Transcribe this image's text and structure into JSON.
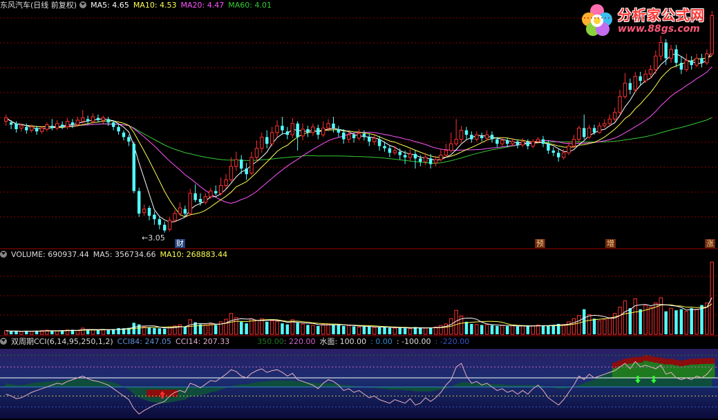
{
  "stock": {
    "title": "东风汽车(日线 前复权)",
    "ma5_label": "MA5: 4.65",
    "ma10_label": "MA10: 4.53",
    "ma20_label": "MA20: 4.47",
    "ma60_label": "MA60: 4.01"
  },
  "volume": {
    "label": "VOLUME: 690937.44",
    "ma5_label": "MA5: 356734.66",
    "ma10_label": "MA10: 268883.44"
  },
  "indicator": {
    "name": "双周期CCI(6,14,95,250,1,2)",
    "cci84_label": "CCI84: 247.05",
    "cci14_label": "CCI14: 207.33",
    "l350": "350.00",
    "l220": ": 220.00",
    "water": "水面: 100.00",
    "l0": ": 0.00",
    "lm100": ": -100.00",
    "lm220": ": -220.00"
  },
  "markers": {
    "cai": "财",
    "yu": "预",
    "zeng": "增",
    "zhang": "涨",
    "low": "←3.05"
  },
  "logo": {
    "main": "分析家公式网",
    "sub": "www.88gs.com"
  },
  "colors": {
    "up": "#ff3232",
    "down": "#54ffff",
    "ma5": "#ffffff",
    "ma10": "#ffff55",
    "ma20": "#ff55ff",
    "ma60": "#33cc33",
    "grid": "#8b0000"
  },
  "chart_data": [
    {
      "type": "candlestick",
      "name": "price",
      "ylim": [
        2.9,
        5.0
      ],
      "candles": [
        [
          4.02,
          4.05,
          4.08,
          3.98
        ],
        [
          4.01,
          3.99,
          4.03,
          3.95
        ],
        [
          4.0,
          3.95,
          4.02,
          3.92
        ],
        [
          3.96,
          3.98,
          4.0,
          3.93
        ],
        [
          3.97,
          3.94,
          4.0,
          3.91
        ],
        [
          3.94,
          3.97,
          3.99,
          3.92
        ],
        [
          3.96,
          3.93,
          3.98,
          3.9
        ],
        [
          3.93,
          3.96,
          3.98,
          3.91
        ],
        [
          3.95,
          3.99,
          4.01,
          3.93
        ],
        [
          3.98,
          3.96,
          4.04,
          3.94
        ],
        [
          3.96,
          4.0,
          4.03,
          3.94
        ],
        [
          3.99,
          3.97,
          4.02,
          3.95
        ],
        [
          3.97,
          4.02,
          4.05,
          3.95
        ],
        [
          4.01,
          3.99,
          4.04,
          3.96
        ],
        [
          3.99,
          4.03,
          4.06,
          3.97
        ],
        [
          4.02,
          4.05,
          4.12,
          4.0
        ],
        [
          4.04,
          4.02,
          4.07,
          3.99
        ],
        [
          4.02,
          4.06,
          4.09,
          4.0
        ],
        [
          4.05,
          4.03,
          4.08,
          4.01
        ],
        [
          4.03,
          4.05,
          4.07,
          4.0
        ],
        [
          4.04,
          4.01,
          4.06,
          3.98
        ],
        [
          4.01,
          3.97,
          4.03,
          3.94
        ],
        [
          3.97,
          3.93,
          3.99,
          3.9
        ],
        [
          3.92,
          3.88,
          3.94,
          3.85
        ],
        [
          3.88,
          3.84,
          3.9,
          3.8
        ],
        [
          3.82,
          3.4,
          3.84,
          3.38
        ],
        [
          3.4,
          3.2,
          3.43,
          3.17
        ],
        [
          3.21,
          3.24,
          3.28,
          3.18
        ],
        [
          3.25,
          3.18,
          3.27,
          3.14
        ],
        [
          3.19,
          3.15,
          3.22,
          3.1
        ],
        [
          3.15,
          3.1,
          3.18,
          3.06
        ],
        [
          3.1,
          3.05,
          3.13,
          3.03
        ],
        [
          3.06,
          3.14,
          3.17,
          3.04
        ],
        [
          3.14,
          3.2,
          3.23,
          3.12
        ],
        [
          3.2,
          3.25,
          3.3,
          3.18
        ],
        [
          3.24,
          3.2,
          3.27,
          3.17
        ],
        [
          3.2,
          3.38,
          3.42,
          3.18
        ],
        [
          3.38,
          3.32,
          3.46,
          3.3
        ],
        [
          3.33,
          3.3,
          3.38,
          3.27
        ],
        [
          3.3,
          3.35,
          3.38,
          3.28
        ],
        [
          3.35,
          3.4,
          3.43,
          3.33
        ],
        [
          3.4,
          3.38,
          3.45,
          3.36
        ],
        [
          3.38,
          3.45,
          3.52,
          3.36
        ],
        [
          3.45,
          3.5,
          3.55,
          3.42
        ],
        [
          3.5,
          3.62,
          3.7,
          3.48
        ],
        [
          3.62,
          3.68,
          3.75,
          3.58
        ],
        [
          3.68,
          3.6,
          3.72,
          3.55
        ],
        [
          3.6,
          3.55,
          3.65,
          3.5
        ],
        [
          3.56,
          3.7,
          3.75,
          3.54
        ],
        [
          3.7,
          3.78,
          3.85,
          3.66
        ],
        [
          3.78,
          3.88,
          3.92,
          3.74
        ],
        [
          3.88,
          3.82,
          3.94,
          3.78
        ],
        [
          3.82,
          3.92,
          3.97,
          3.8
        ],
        [
          3.92,
          3.98,
          4.03,
          3.88
        ],
        [
          3.98,
          3.94,
          4.06,
          3.9
        ],
        [
          3.93,
          3.9,
          3.97,
          3.86
        ],
        [
          3.9,
          4.0,
          4.05,
          3.87
        ],
        [
          4.0,
          3.88,
          4.02,
          3.76
        ],
        [
          3.89,
          3.95,
          4.0,
          3.85
        ],
        [
          3.95,
          3.92,
          3.98,
          3.88
        ],
        [
          3.92,
          3.97,
          4.0,
          3.89
        ],
        [
          3.96,
          3.9,
          3.99,
          3.86
        ],
        [
          3.9,
          3.96,
          4.02,
          3.88
        ],
        [
          3.96,
          4.0,
          4.04,
          3.93
        ],
        [
          4.0,
          3.96,
          4.06,
          3.92
        ],
        [
          3.95,
          3.92,
          3.98,
          3.88
        ],
        [
          3.92,
          3.86,
          3.95,
          3.82
        ],
        [
          3.86,
          3.9,
          3.93,
          3.83
        ],
        [
          3.9,
          3.87,
          3.92,
          3.83
        ],
        [
          3.87,
          3.91,
          3.95,
          3.85
        ],
        [
          3.91,
          3.88,
          3.94,
          3.85
        ],
        [
          3.88,
          3.84,
          3.91,
          3.8
        ],
        [
          3.84,
          3.87,
          3.9,
          3.81
        ],
        [
          3.86,
          3.8,
          3.89,
          3.76
        ],
        [
          3.8,
          3.78,
          3.84,
          3.75
        ],
        [
          3.78,
          3.74,
          3.81,
          3.7
        ],
        [
          3.74,
          3.76,
          3.8,
          3.72
        ],
        [
          3.75,
          3.72,
          3.78,
          3.68
        ],
        [
          3.72,
          3.7,
          3.76,
          3.64
        ],
        [
          3.7,
          3.73,
          3.77,
          3.67
        ],
        [
          3.73,
          3.69,
          3.76,
          3.6
        ],
        [
          3.69,
          3.66,
          3.72,
          3.62
        ],
        [
          3.66,
          3.7,
          3.74,
          3.63
        ],
        [
          3.69,
          3.64,
          3.73,
          3.6
        ],
        [
          3.65,
          3.68,
          3.71,
          3.62
        ],
        [
          3.68,
          3.72,
          3.77,
          3.66
        ],
        [
          3.72,
          3.76,
          3.82,
          3.7
        ],
        [
          3.76,
          3.82,
          3.92,
          3.74
        ],
        [
          3.82,
          3.86,
          4.04,
          3.8
        ],
        [
          3.86,
          3.94,
          3.98,
          3.83
        ],
        [
          3.94,
          3.9,
          3.97,
          3.86
        ],
        [
          3.9,
          3.86,
          3.93,
          3.83
        ],
        [
          3.86,
          3.9,
          3.93,
          3.84
        ],
        [
          3.89,
          3.87,
          3.92,
          3.84
        ],
        [
          3.87,
          3.9,
          3.94,
          3.85
        ],
        [
          3.9,
          3.86,
          3.93,
          3.83
        ],
        [
          3.86,
          3.82,
          3.88,
          3.79
        ],
        [
          3.82,
          3.85,
          3.88,
          3.8
        ],
        [
          3.85,
          3.82,
          3.87,
          3.79
        ],
        [
          3.82,
          3.84,
          3.87,
          3.8
        ],
        [
          3.84,
          3.81,
          3.86,
          3.78
        ],
        [
          3.81,
          3.84,
          3.87,
          3.79
        ],
        [
          3.84,
          3.8,
          3.86,
          3.77
        ],
        [
          3.8,
          3.84,
          3.86,
          3.78
        ],
        [
          3.84,
          3.86,
          3.88,
          3.82
        ],
        [
          3.86,
          3.82,
          3.89,
          3.79
        ],
        [
          3.82,
          3.76,
          3.85,
          3.73
        ],
        [
          3.76,
          3.74,
          3.79,
          3.71
        ],
        [
          3.74,
          3.7,
          3.77,
          3.66
        ],
        [
          3.7,
          3.74,
          3.77,
          3.68
        ],
        [
          3.74,
          3.8,
          3.84,
          3.72
        ],
        [
          3.8,
          3.86,
          3.9,
          3.78
        ],
        [
          3.86,
          3.96,
          3.98,
          3.84
        ],
        [
          3.96,
          3.88,
          4.08,
          3.86
        ],
        [
          3.88,
          3.96,
          3.99,
          3.86
        ],
        [
          3.96,
          3.92,
          3.99,
          3.9
        ],
        [
          3.92,
          3.98,
          4.01,
          3.91
        ],
        [
          3.98,
          4.0,
          4.04,
          3.96
        ],
        [
          4.0,
          4.04,
          4.08,
          3.98
        ],
        [
          4.04,
          4.1,
          4.14,
          4.02
        ],
        [
          4.1,
          4.24,
          4.3,
          4.08
        ],
        [
          4.24,
          4.36,
          4.45,
          4.22
        ],
        [
          4.36,
          4.3,
          4.4,
          4.26
        ],
        [
          4.3,
          4.42,
          4.46,
          4.28
        ],
        [
          4.42,
          4.38,
          4.46,
          4.34
        ],
        [
          4.38,
          4.44,
          4.48,
          4.36
        ],
        [
          4.44,
          4.48,
          4.52,
          4.4
        ],
        [
          4.48,
          4.6,
          4.65,
          4.44
        ],
        [
          4.6,
          4.72,
          4.78,
          4.56
        ],
        [
          4.72,
          4.58,
          4.75,
          4.52
        ],
        [
          4.58,
          4.66,
          4.7,
          4.54
        ],
        [
          4.66,
          4.54,
          4.7,
          4.5
        ],
        [
          4.54,
          4.48,
          4.6,
          4.44
        ],
        [
          4.48,
          4.56,
          4.62,
          4.46
        ],
        [
          4.56,
          4.52,
          4.6,
          4.48
        ],
        [
          4.52,
          4.58,
          4.62,
          4.5
        ],
        [
          4.58,
          4.54,
          4.62,
          4.5
        ],
        [
          4.54,
          4.62,
          4.66,
          4.52
        ],
        [
          4.62,
          4.96,
          5.0,
          4.6
        ]
      ],
      "lines": {
        "ma5_color": "#ffffff",
        "ma10_color": "#ffff55",
        "ma20_color": "#ff55ff",
        "ma60_color": "#33cc33"
      }
    },
    {
      "type": "bar",
      "name": "volume",
      "ylim": [
        0,
        700000
      ],
      "values": [
        35000,
        28000,
        30000,
        26000,
        32000,
        30000,
        34000,
        36000,
        40000,
        34000,
        32000,
        38000,
        42000,
        44000,
        36000,
        60000,
        48000,
        44000,
        40000,
        42000,
        46000,
        50000,
        60000,
        58000,
        62000,
        110000,
        95000,
        72000,
        65000,
        60000,
        58000,
        54000,
        70000,
        80000,
        92000,
        70000,
        140000,
        115000,
        95000,
        90000,
        100000,
        88000,
        120000,
        145000,
        200000,
        160000,
        120000,
        105000,
        150000,
        135000,
        150000,
        120000,
        130000,
        125000,
        105000,
        95000,
        140000,
        110000,
        98000,
        90000,
        86000,
        80000,
        95000,
        100000,
        92000,
        88000,
        80000,
        84000,
        76000,
        70000,
        75000,
        72000,
        68000,
        66000,
        70000,
        62000,
        60000,
        64000,
        58000,
        55000,
        70000,
        62000,
        60000,
        64000,
        70000,
        85000,
        100000,
        150000,
        230000,
        175000,
        120000,
        100000,
        95000,
        90000,
        92000,
        88000,
        80000,
        84000,
        78000,
        82000,
        76000,
        80000,
        78000,
        82000,
        90000,
        86000,
        84000,
        90000,
        100000,
        95000,
        120000,
        150000,
        180000,
        240000,
        190000,
        150000,
        130000,
        140000,
        160000,
        200000,
        260000,
        320000,
        250000,
        340000,
        240000,
        280000,
        260000,
        300000,
        350000,
        220000,
        250000,
        230000,
        240000,
        220000,
        250000,
        240000,
        280000,
        300000,
        690937
      ]
    },
    {
      "type": "line",
      "name": "cci",
      "ylim": [
        -350,
        420
      ],
      "cci14": [
        -80,
        -100,
        -130,
        -120,
        -90,
        -60,
        -40,
        -20,
        0,
        20,
        40,
        30,
        60,
        80,
        100,
        120,
        90,
        70,
        60,
        40,
        20,
        -20,
        -60,
        -100,
        -140,
        -240,
        -300,
        -260,
        -230,
        -200,
        -180,
        -160,
        -100,
        -60,
        -40,
        -60,
        40,
        20,
        -10,
        30,
        70,
        60,
        100,
        140,
        190,
        170,
        120,
        100,
        150,
        180,
        200,
        160,
        180,
        190,
        160,
        120,
        150,
        80,
        60,
        40,
        20,
        -20,
        40,
        80,
        60,
        20,
        -40,
        -20,
        -60,
        -40,
        -80,
        -120,
        -100,
        -140,
        -160,
        -180,
        -140,
        -160,
        -180,
        -130,
        -200,
        -180,
        -120,
        -160,
        -120,
        -60,
        20,
        80,
        220,
        260,
        120,
        40,
        60,
        20,
        40,
        0,
        -40,
        -20,
        -60,
        -40,
        -80,
        -40,
        -80,
        -20,
        20,
        -40,
        -120,
        -160,
        -200,
        -140,
        -60,
        20,
        120,
        80,
        140,
        100,
        120,
        140,
        160,
        180,
        220,
        260,
        200,
        280,
        220,
        240,
        220,
        200,
        240,
        140,
        160,
        100,
        80,
        100,
        80,
        120,
        100,
        140,
        207
      ],
      "cci84": [
        40,
        30,
        20,
        20,
        30,
        40,
        50,
        50,
        60,
        60,
        70,
        70,
        80,
        80,
        90,
        90,
        80,
        80,
        70,
        70,
        60,
        50,
        30,
        0,
        -30,
        -80,
        -120,
        -140,
        -160,
        -170,
        -180,
        -180,
        -170,
        -160,
        -150,
        -140,
        -110,
        -100,
        -90,
        -80,
        -60,
        -50,
        -30,
        -10,
        10,
        20,
        30,
        30,
        40,
        50,
        60,
        60,
        70,
        70,
        70,
        70,
        70,
        60,
        60,
        50,
        50,
        40,
        40,
        40,
        40,
        30,
        20,
        20,
        10,
        10,
        0,
        -10,
        -10,
        -20,
        -20,
        -30,
        -30,
        -30,
        -40,
        -40,
        -50,
        -50,
        -50,
        -50,
        -40,
        -30,
        -20,
        0,
        30,
        50,
        50,
        40,
        40,
        40,
        40,
        30,
        30,
        30,
        20,
        20,
        20,
        20,
        20,
        20,
        20,
        10,
        0,
        -10,
        -20,
        -20,
        -10,
        0,
        20,
        40,
        60,
        80,
        110,
        140,
        170,
        200,
        220,
        240,
        250,
        260,
        260,
        280,
        270,
        260,
        250,
        240,
        240,
        230,
        220,
        230,
        240,
        240,
        245,
        247,
        247
      ],
      "levels": [
        350,
        220,
        100,
        0,
        -100,
        -220
      ]
    }
  ]
}
